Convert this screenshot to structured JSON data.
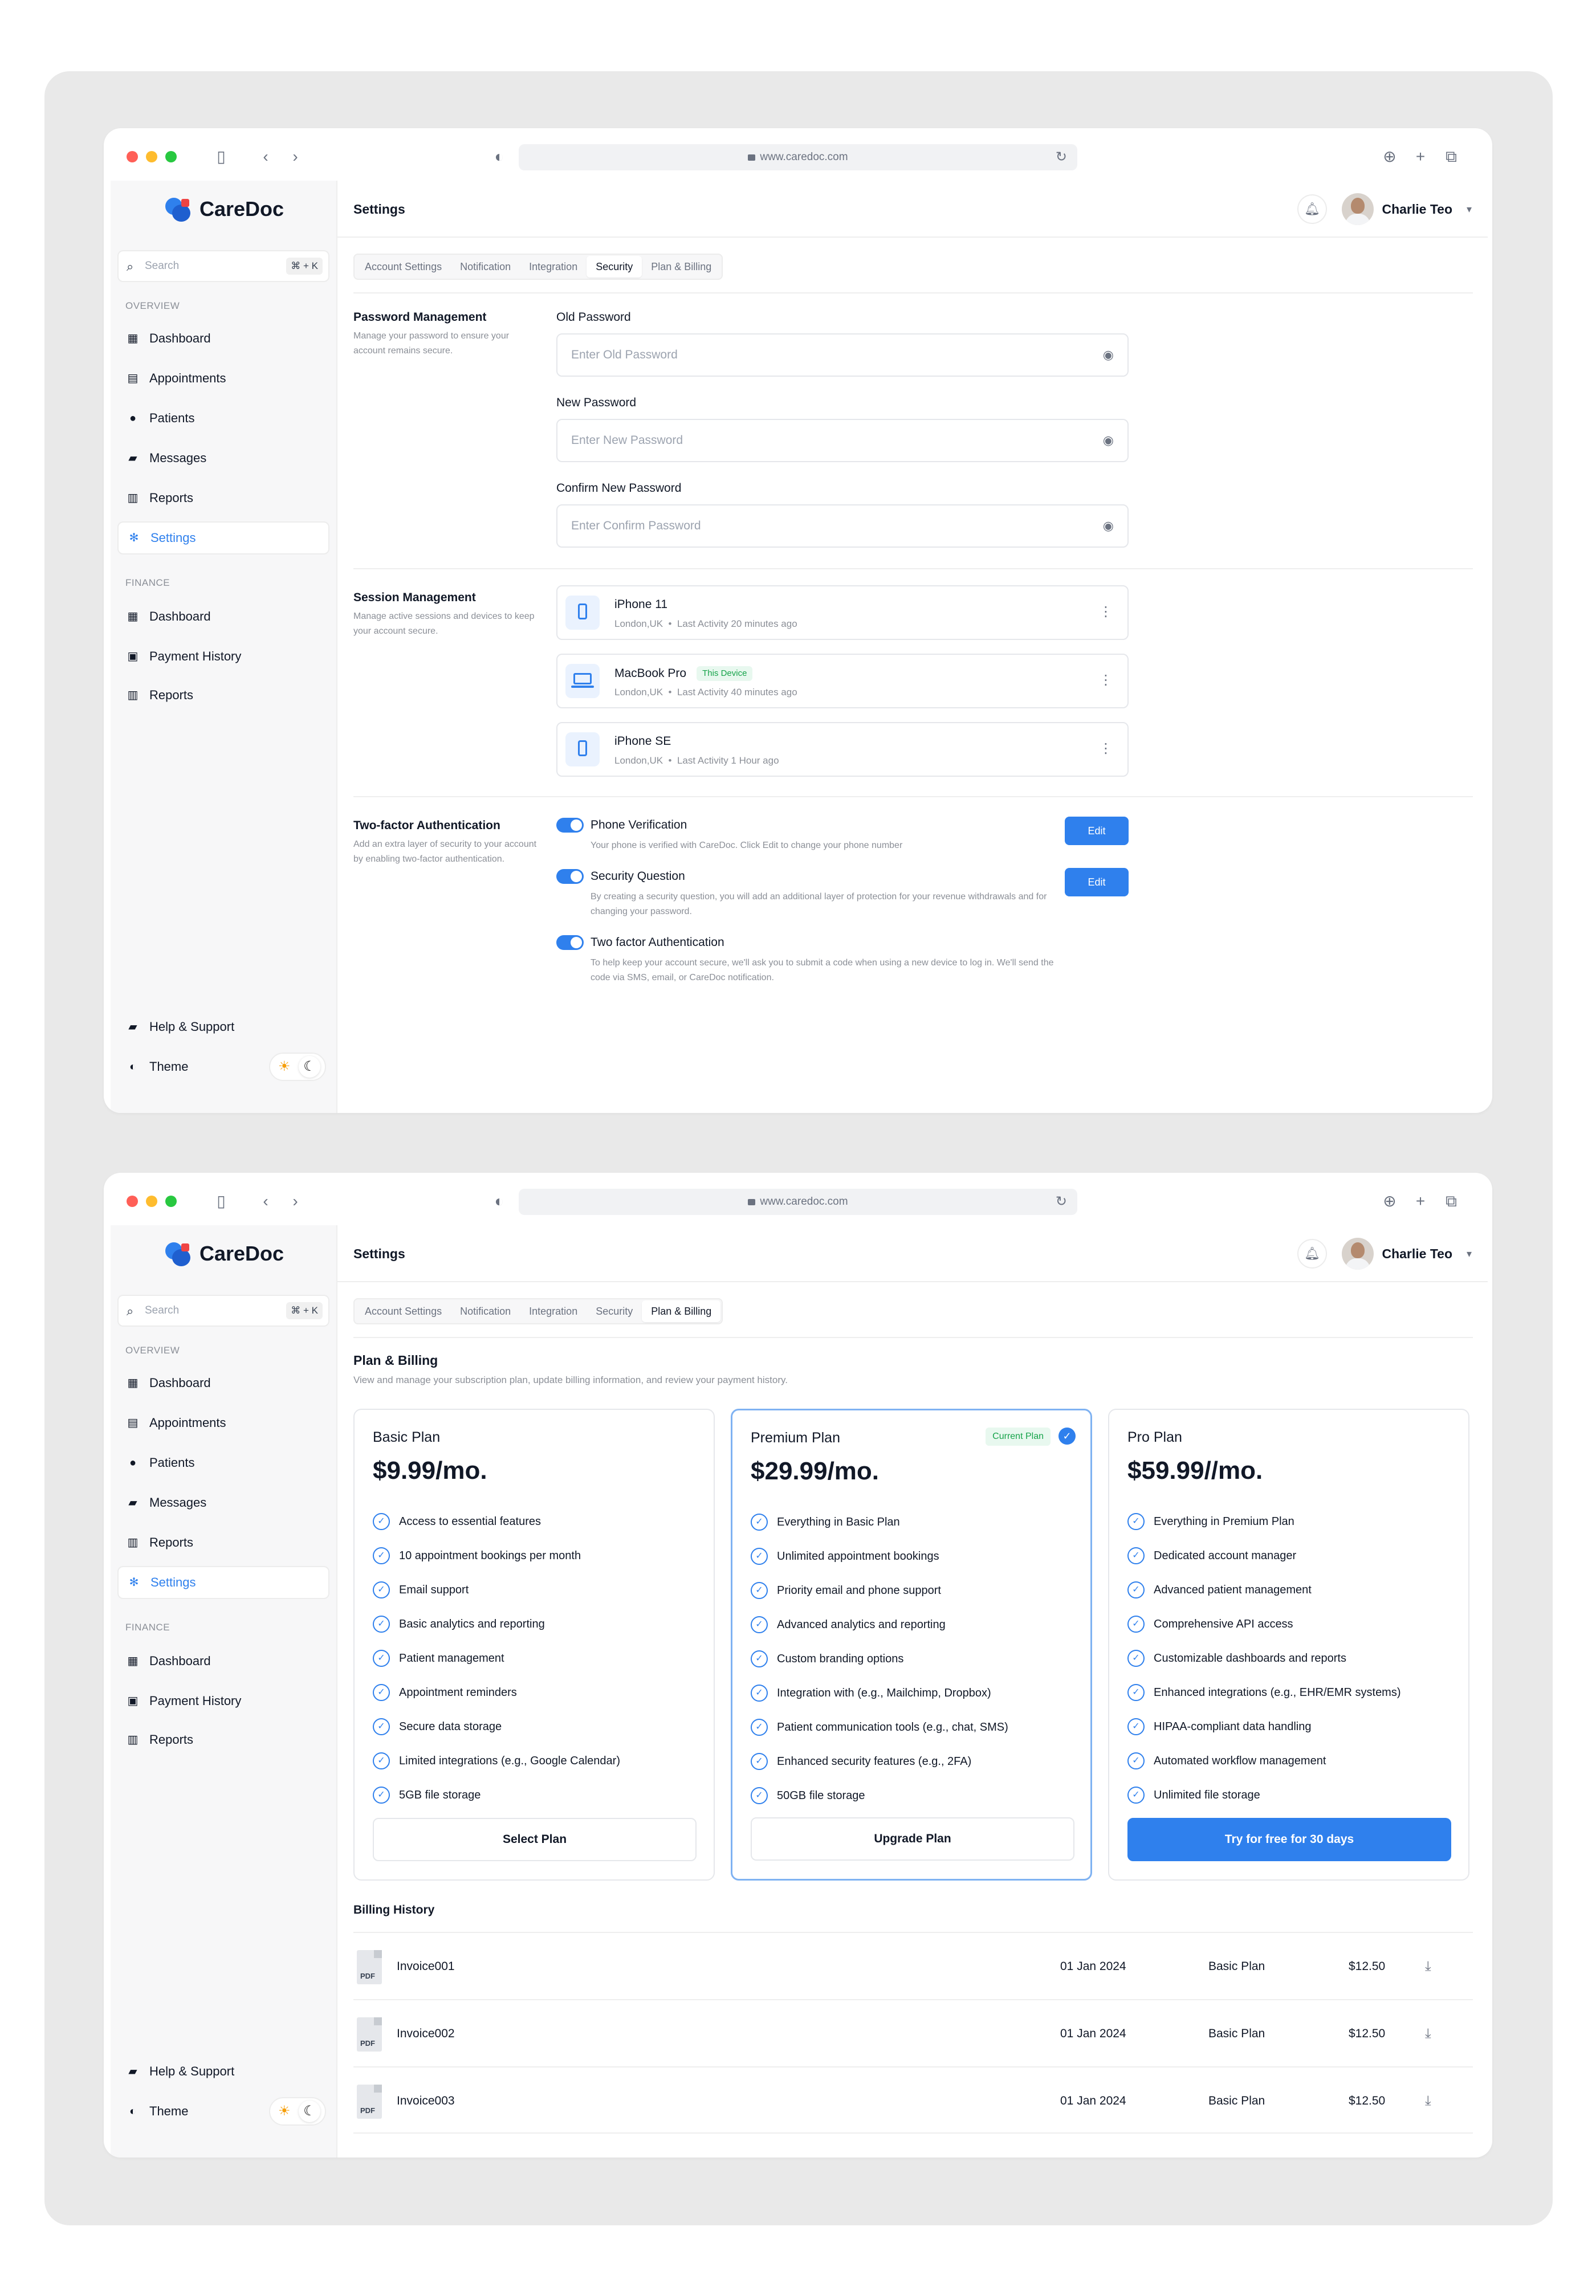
{
  "browser": {
    "url": "www.caredoc.com"
  },
  "brand": {
    "name": "CareDoc",
    "accent": "#2f80ed"
  },
  "sidebar": {
    "search_placeholder": "Search",
    "search_shortcut": "⌘ + K",
    "overview_heading": "OVERVIEW",
    "overview_items": [
      {
        "label": "Dashboard",
        "icon": "grid-icon"
      },
      {
        "label": "Appointments",
        "icon": "calendar-icon"
      },
      {
        "label": "Patients",
        "icon": "users-icon"
      },
      {
        "label": "Messages",
        "icon": "message-icon"
      },
      {
        "label": "Reports",
        "icon": "report-icon"
      },
      {
        "label": "Settings",
        "icon": "gear-icon",
        "active": true
      }
    ],
    "finance_heading": "FINANCE",
    "finance_items": [
      {
        "label": "Dashboard",
        "icon": "grid-icon"
      },
      {
        "label": "Payment History",
        "icon": "wallet-icon"
      },
      {
        "label": "Reports",
        "icon": "report-icon"
      }
    ],
    "help_label": "Help & Support",
    "theme_label": "Theme"
  },
  "header": {
    "title": "Settings",
    "user_name": "Charlie Teo"
  },
  "tabs": [
    "Account Settings",
    "Notification",
    "Integration",
    "Security",
    "Plan & Billing"
  ],
  "security": {
    "password": {
      "title": "Password Management",
      "desc": "Manage your password to ensure your account remains secure.",
      "fields": [
        {
          "label": "Old Password",
          "placeholder": "Enter Old Password"
        },
        {
          "label": "New Password",
          "placeholder": "Enter New Password"
        },
        {
          "label": "Confirm New Password",
          "placeholder": "Enter Confirm Password"
        }
      ]
    },
    "sessions": {
      "title": "Session Management",
      "desc": "Manage active sessions and devices to keep your account secure.",
      "items": [
        {
          "device": "iPhone 11",
          "location": "London,UK",
          "activity": "Last Activity 20 minutes ago",
          "tag": "",
          "kind": "phone"
        },
        {
          "device": "MacBook Pro",
          "location": "London,UK",
          "activity": "Last Activity 40 minutes ago",
          "tag": "This Device",
          "kind": "laptop"
        },
        {
          "device": "iPhone SE",
          "location": "London,UK",
          "activity": "Last Activity 1 Hour ago",
          "tag": "",
          "kind": "phone"
        }
      ]
    },
    "twofactor": {
      "title": "Two-factor Authentication",
      "desc": "Add an extra layer of security to your account by enabling two-factor authentication.",
      "edit_label": "Edit",
      "items": [
        {
          "title": "Phone Verification",
          "desc": "Your phone is verified with CareDoc. Click Edit to change your phone number",
          "enabled": true
        },
        {
          "title": "Security Question",
          "desc": "By creating a security question, you will add an additional layer of protection for your revenue withdrawals and for changing your password.",
          "enabled": true
        },
        {
          "title": "Two factor Authentication",
          "desc": "To help keep your account secure, we'll ask you to submit a code when using a new device to log in. We'll send the code via SMS, email, or CareDoc notification.",
          "enabled": true
        }
      ]
    }
  },
  "billing": {
    "title": "Plan & Billing",
    "desc": "View and manage your subscription plan, update billing information, and review your payment history.",
    "plans": [
      {
        "name": "Basic Plan",
        "price": "$9.99/mo.",
        "current": false,
        "button": "Select Plan",
        "primary": false,
        "features": [
          "Access to essential features",
          "10 appointment bookings per month",
          "Email support",
          "Basic analytics and reporting",
          "Patient management",
          "Appointment reminders",
          "Secure data storage",
          "Limited integrations (e.g., Google Calendar)",
          "5GB file storage"
        ]
      },
      {
        "name": "Premium Plan",
        "price": "$29.99/mo.",
        "current": true,
        "current_label": "Current Plan",
        "button": "Upgrade Plan",
        "primary": false,
        "features": [
          "Everything in Basic Plan",
          "Unlimited appointment bookings",
          "Priority email and phone support",
          "Advanced analytics and reporting",
          "Custom branding options",
          "Integration with (e.g., Mailchimp, Dropbox)",
          "Patient communication tools (e.g., chat, SMS)",
          "Enhanced security features (e.g., 2FA)",
          "50GB file storage"
        ]
      },
      {
        "name": "Pro Plan",
        "price": "$59.99//mo.",
        "current": false,
        "button": "Try for free for 30 days",
        "primary": true,
        "features": [
          "Everything in Premium Plan",
          "Dedicated account manager",
          "Advanced patient management",
          "Comprehensive API access",
          "Customizable dashboards and reports",
          "Enhanced integrations (e.g., EHR/EMR systems)",
          "HIPAA-compliant data handling",
          "Automated workflow management",
          "Unlimited file storage"
        ]
      }
    ],
    "history_title": "Billing History",
    "file_type": "PDF",
    "history": [
      {
        "invoice": "Invoice001",
        "date": "01 Jan 2024",
        "plan": "Basic Plan",
        "amount": "$12.50"
      },
      {
        "invoice": "Invoice002",
        "date": "01 Jan 2024",
        "plan": "Basic Plan",
        "amount": "$12.50"
      },
      {
        "invoice": "Invoice003",
        "date": "01 Jan 2024",
        "plan": "Basic Plan",
        "amount": "$12.50"
      }
    ]
  }
}
